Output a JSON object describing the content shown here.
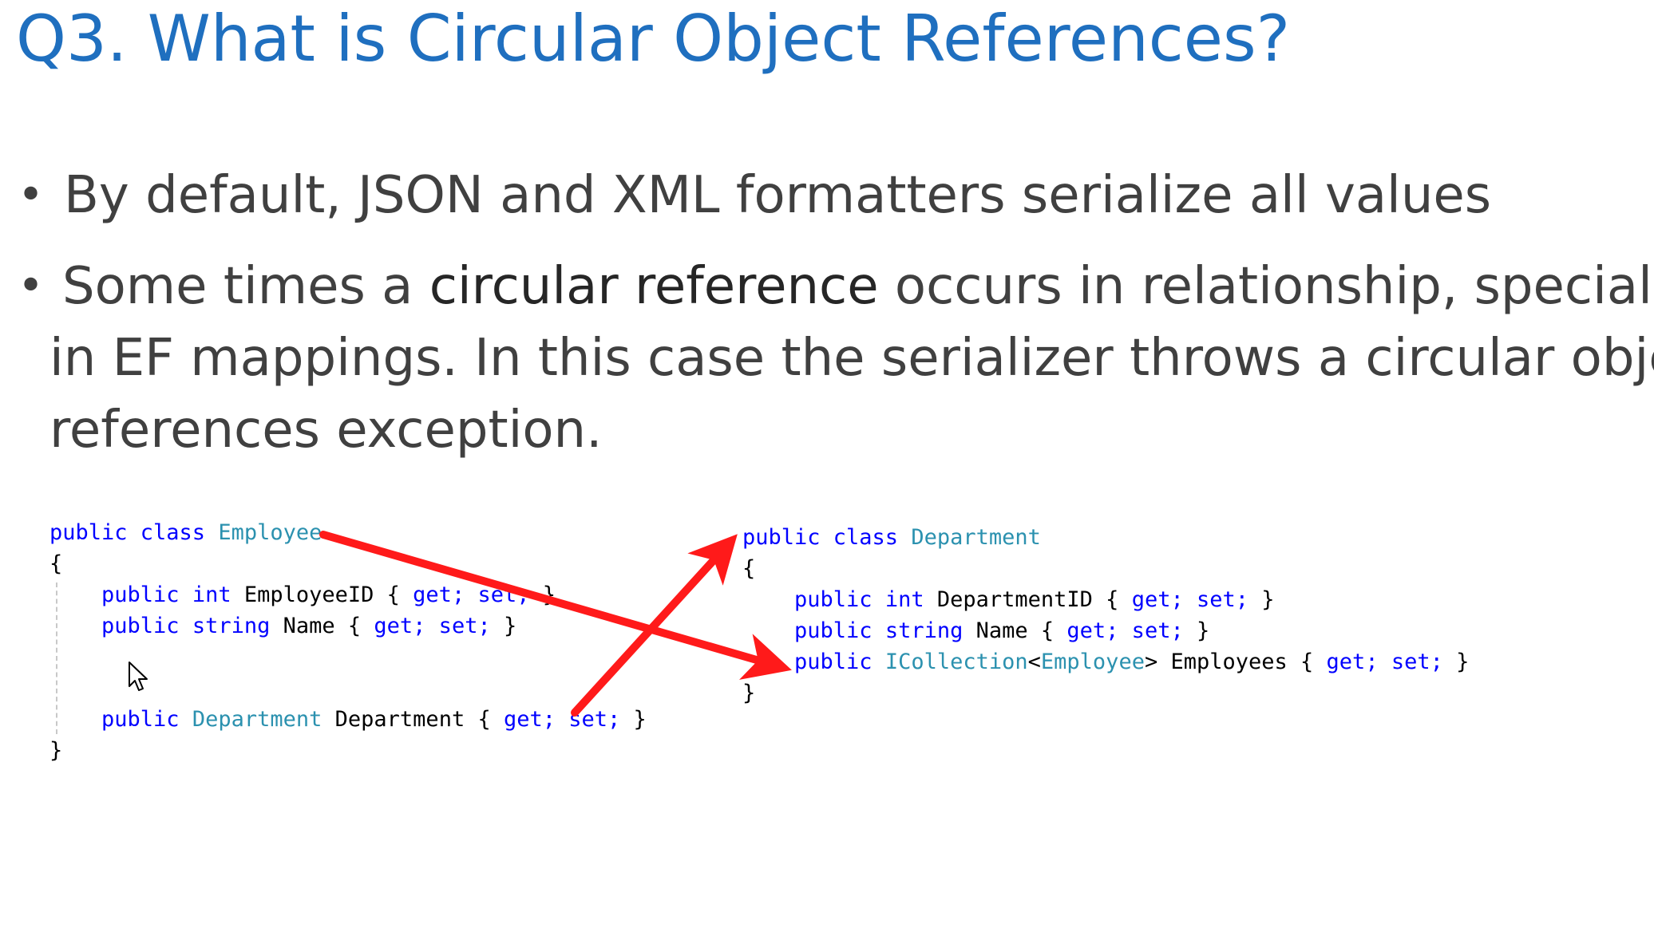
{
  "slide": {
    "title": "Q3. What is Circular Object References?",
    "bullets": {
      "first": "By default, JSON and XML formatters serialize all values",
      "second": {
        "line1_before": "Some times a ",
        "line1_emphasis": "circular reference",
        "line1_after": " occurs in relationship, specially",
        "line2": "in EF mappings. In this case the serializer throws a circular object",
        "line3": "references exception."
      },
      "dot": "•"
    },
    "employee_code": {
      "l1_kw": "public class ",
      "l1_type": "Employee",
      "open_brace": "{",
      "l2_kw": "public int ",
      "l2_rest": "EmployeeID { ",
      "l2_acc": "get; set;",
      "l2_end": " }",
      "l3_kw": "public string ",
      "l3_rest": "Name { ",
      "l3_acc": "get; set;",
      "l3_end": " }",
      "l4_kw": "public ",
      "l4_type": "Department",
      "l4_rest": " Department { ",
      "l4_acc": "get; set;",
      "l4_end": " }",
      "close_brace": "}"
    },
    "department_code": {
      "l1_kw": "public class ",
      "l1_type": "Department",
      "open_brace": "{",
      "l2_kw": "public int ",
      "l2_rest": "DepartmentID { ",
      "l2_acc": "get; set;",
      "l2_end": " }",
      "l3_kw": "public string ",
      "l3_rest": "Name { ",
      "l3_acc": "get; set;",
      "l3_end": " }",
      "l4_kw": "public ",
      "l4_type1": "ICollection",
      "l4_lt": "<",
      "l4_type2": "Employee",
      "l4_gt": ">",
      "l4_rest": " Employees { ",
      "l4_acc": "get; set;",
      "l4_end": " }",
      "close_brace": "}"
    },
    "colors": {
      "title": "#1f6fbf",
      "body_text": "#404040",
      "keyword": "#0000ff",
      "type_name": "#2b91af",
      "arrow": "#ff1a1a"
    },
    "icons": {
      "cursor": "mouse-pointer-icon",
      "arrow": "red-arrow"
    }
  }
}
